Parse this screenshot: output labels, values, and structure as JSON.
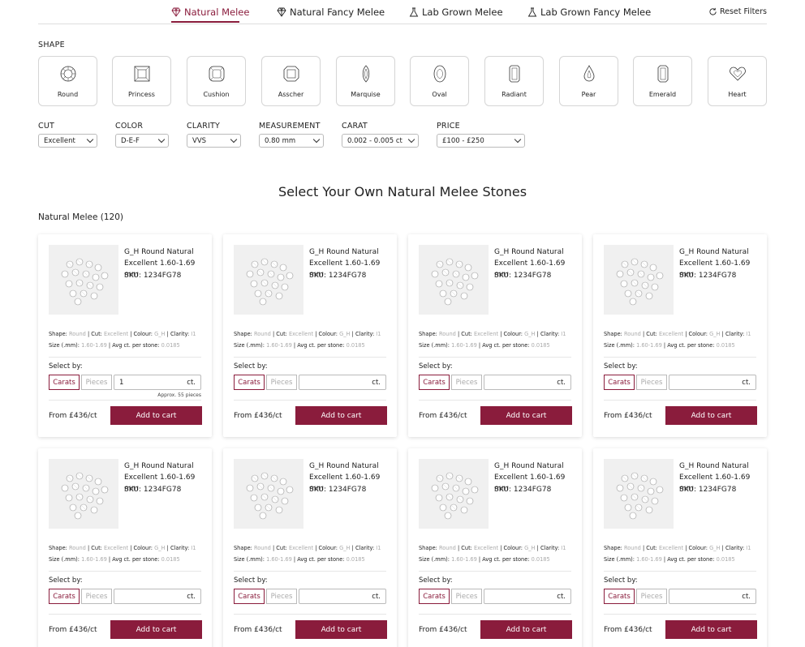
{
  "tabs": [
    {
      "label": "Natural Melee",
      "icon": "diamond-icon",
      "active": true
    },
    {
      "label": "Natural Fancy Melee",
      "icon": "diamond-icon",
      "active": false
    },
    {
      "label": "Lab Grown Melee",
      "icon": "flask-icon",
      "active": false
    },
    {
      "label": "Lab Grown Fancy Melee",
      "icon": "flask-icon",
      "active": false
    }
  ],
  "reset_label": "Reset Filters",
  "shape_title": "SHAPE",
  "shapes": [
    "Round",
    "Princess",
    "Cushion",
    "Asscher",
    "Marquise",
    "Oval",
    "Radiant",
    "Pear",
    "Emerald",
    "Heart"
  ],
  "filters": [
    {
      "label": "CUT",
      "value": "Excellent"
    },
    {
      "label": "COLOR",
      "value": "D-E-F"
    },
    {
      "label": "CLARITY",
      "value": "VVS"
    },
    {
      "label": "MEASUREMENT",
      "value": "0.80 mm"
    },
    {
      "label": "CARAT",
      "value": "0.002 - 0.005 ct"
    },
    {
      "label": "PRICE",
      "value": "£100 - £250"
    }
  ],
  "heading": "Select Your Own Natural Melee Stones",
  "results_count": "Natural Melee (120)",
  "product_common": {
    "title_line1": "G_H Round Natural",
    "title_line2": "Excellent 1.60-1.69 mm",
    "sku": "SKU: 1234FG78",
    "shape_label": "Shape:",
    "shape_value": "Round",
    "cut_label": "Cut:",
    "cut_value": "Excellent",
    "colour_label": "Colour:",
    "colour_value": "G_H",
    "clarity_label": "Clarity:",
    "clarity_value": "I1",
    "size_label": "Size (.mm):",
    "size_value": "1.60-1.69",
    "avg_label": "Avg ct. per stone:",
    "avg_value": "0.0185",
    "select_by": "Select by:",
    "carats": "Carats",
    "pieces": "Pieces",
    "unit": "ct.",
    "price": "From £436/ct",
    "add_to_cart": "Add to cart"
  },
  "products": [
    {
      "qty": "1",
      "approx": "Approx. 55 pieces"
    },
    {
      "qty": "",
      "approx": ""
    },
    {
      "qty": "",
      "approx": ""
    },
    {
      "qty": "",
      "approx": ""
    },
    {
      "qty": "",
      "approx": ""
    },
    {
      "qty": "",
      "approx": ""
    },
    {
      "qty": "",
      "approx": ""
    },
    {
      "qty": "",
      "approx": ""
    }
  ],
  "colors": {
    "accent": "#8a1c3c",
    "border": "#d5d5d5"
  }
}
